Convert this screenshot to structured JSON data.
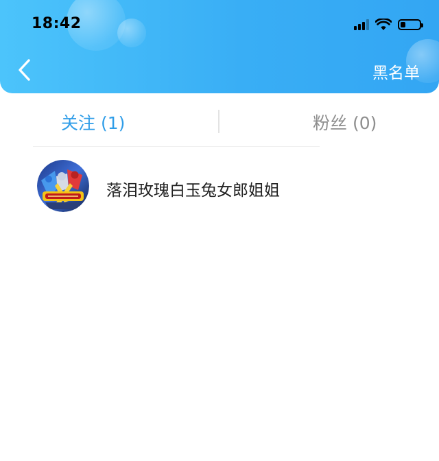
{
  "status_bar": {
    "time": "18:42",
    "signal_bars": 4,
    "signal_active_bars": 3,
    "battery_level": 0.25
  },
  "header": {
    "back_icon": "chevron-left-icon",
    "right_action": "黑名单",
    "gradient_colors": [
      "#4cc4fb",
      "#33a6f3"
    ]
  },
  "tabs": [
    {
      "label": "关注 (1)",
      "active": true
    },
    {
      "label": "粉丝 (0)",
      "active": false
    }
  ],
  "accent_color": "#2f9de8",
  "following_list": [
    {
      "name": "落泪玫瑰白玉兔女郎姐姐",
      "avatar_icon": "cartoon-avatar-icon"
    }
  ]
}
